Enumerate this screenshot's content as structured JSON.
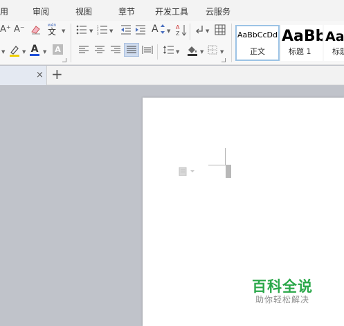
{
  "menu": {
    "items": [
      {
        "label": "用"
      },
      {
        "label": "审阅"
      },
      {
        "label": "视图"
      },
      {
        "label": "章节"
      },
      {
        "label": "开发工具"
      },
      {
        "label": "云服务"
      }
    ]
  },
  "ribbon": {
    "font_grow_glyph": "A⁺",
    "font_shrink_glyph": "A⁻",
    "phonetic_glyph": "文",
    "phonetic_ruby": "wén",
    "font_color_glyph": "A",
    "char_shading_glyph": "A",
    "char_scale_glyph": "A",
    "font_color": "#1f4fd8",
    "highlight_color": "#f0d000",
    "fill_color": "#333333"
  },
  "styles": {
    "items": [
      {
        "sample": "AaBbCcDd",
        "name": "正文",
        "selected": true
      },
      {
        "sample": "AaBb",
        "name": "标题 1",
        "selected": false
      },
      {
        "sample": "Aa",
        "name": "标题",
        "selected": false
      }
    ]
  },
  "tabs": {
    "close_glyph": "×",
    "add_glyph": "+"
  },
  "watermark": {
    "title": "百科全说",
    "subtitle": "助你轻松解决",
    "color": "#2ba84a"
  }
}
